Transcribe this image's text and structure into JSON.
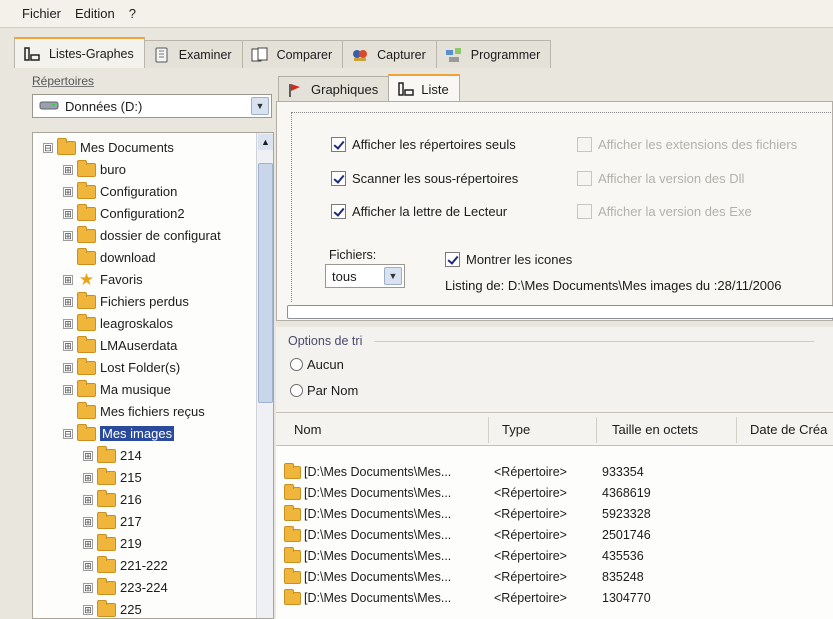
{
  "menu": [
    "Fichier",
    "Edition",
    "?"
  ],
  "main_tabs": [
    {
      "label": "Listes-Graphes",
      "icon": "list-graph-icon",
      "active": true
    },
    {
      "label": "Examiner",
      "icon": "examine-icon",
      "active": false
    },
    {
      "label": "Comparer",
      "icon": "compare-icon",
      "active": false
    },
    {
      "label": "Capturer",
      "icon": "capture-icon",
      "active": false
    },
    {
      "label": "Programmer",
      "icon": "schedule-icon",
      "active": false
    }
  ],
  "left": {
    "repertoires_label": "Répertoires",
    "drive": "Données (D:)",
    "tree": [
      {
        "label": "Mes Documents",
        "expander": "⊟",
        "level": 0
      },
      {
        "label": "buro",
        "expander": "⊞",
        "level": 1
      },
      {
        "label": "Configuration",
        "expander": "⊞",
        "level": 1
      },
      {
        "label": "Configuration2",
        "expander": "⊞",
        "level": 1
      },
      {
        "label": "dossier de configurat",
        "expander": "⊞",
        "level": 1
      },
      {
        "label": "download",
        "expander": "",
        "level": 1
      },
      {
        "label": "Favoris",
        "expander": "⊞",
        "level": 1,
        "star": true
      },
      {
        "label": "Fichiers perdus",
        "expander": "⊞",
        "level": 1
      },
      {
        "label": "leagroskalos",
        "expander": "⊞",
        "level": 1
      },
      {
        "label": "LMAuserdata",
        "expander": "⊞",
        "level": 1
      },
      {
        "label": "Lost Folder(s)",
        "expander": "⊞",
        "level": 1
      },
      {
        "label": "Ma musique",
        "expander": "⊞",
        "level": 1
      },
      {
        "label": "Mes fichiers reçus",
        "expander": "",
        "level": 1
      },
      {
        "label": "Mes images",
        "expander": "⊟",
        "level": 1,
        "selected": true
      },
      {
        "label": "214",
        "expander": "⊞",
        "level": 2
      },
      {
        "label": "215",
        "expander": "⊞",
        "level": 2
      },
      {
        "label": "216",
        "expander": "⊞",
        "level": 2
      },
      {
        "label": "217",
        "expander": "⊞",
        "level": 2
      },
      {
        "label": "219",
        "expander": "⊞",
        "level": 2
      },
      {
        "label": "221-222",
        "expander": "⊞",
        "level": 2
      },
      {
        "label": "223-224",
        "expander": "⊞",
        "level": 2
      },
      {
        "label": "225",
        "expander": "⊞",
        "level": 2
      }
    ]
  },
  "sub_tabs": [
    {
      "label": "Graphiques",
      "icon": "graph-flag-icon",
      "active": false
    },
    {
      "label": "Liste",
      "icon": "list-icon",
      "active": true
    }
  ],
  "options": {
    "afficher_reps": "Afficher les répertoires seuls",
    "scanner": "Scanner les sous-répertoires",
    "lettre": "Afficher la lettre de Lecteur",
    "extensions": "Afficher les extensions des fichiers",
    "version_dll": "Afficher la version des Dll",
    "version_exe": "Afficher la version des Exe",
    "fichiers_label": "Fichiers:",
    "fichiers_value": "tous",
    "montrer_icones": "Montrer les icones",
    "listing": "Listing de: D:\\Mes Documents\\Mes images du :28/11/2006"
  },
  "tri": {
    "label": "Options de tri",
    "aucun": "Aucun",
    "par_nom": "Par Nom"
  },
  "list": {
    "columns": [
      "Nom",
      "Type",
      "Taille en octets",
      "Date de Créa"
    ],
    "rows": [
      {
        "name": "[D:\\Mes Documents\\Mes...",
        "type": "<Répertoire>",
        "size": "933354"
      },
      {
        "name": "[D:\\Mes Documents\\Mes...",
        "type": "<Répertoire>",
        "size": "4368619"
      },
      {
        "name": "[D:\\Mes Documents\\Mes...",
        "type": "<Répertoire>",
        "size": "5923328"
      },
      {
        "name": "[D:\\Mes Documents\\Mes...",
        "type": "<Répertoire>",
        "size": "2501746"
      },
      {
        "name": "[D:\\Mes Documents\\Mes...",
        "type": "<Répertoire>",
        "size": "435536"
      },
      {
        "name": "[D:\\Mes Documents\\Mes...",
        "type": "<Répertoire>",
        "size": "835248"
      },
      {
        "name": "[D:\\Mes Documents\\Mes...",
        "type": "<Répertoire>",
        "size": "1304770"
      }
    ]
  }
}
